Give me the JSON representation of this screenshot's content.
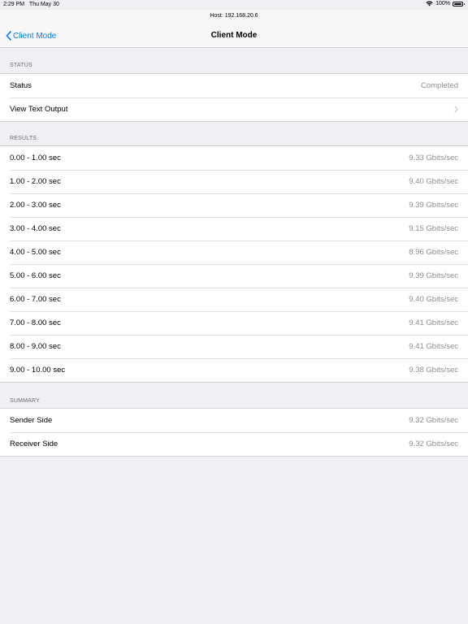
{
  "status_bar": {
    "time": "2:29 PM",
    "date": "Thu May 30",
    "battery": "100%",
    "wifi_icon": "wifi-icon",
    "battery_icon": "battery-icon"
  },
  "nav": {
    "prompt": "Host: 192.168.20.6",
    "back_label": "Client Mode",
    "title": "Client Mode"
  },
  "status_section": {
    "header": "STATUS",
    "rows": [
      {
        "label": "Status",
        "value": "Completed"
      },
      {
        "label": "View Text Output",
        "value": ""
      }
    ]
  },
  "results_section": {
    "header": "RESULTS",
    "rows": [
      {
        "label": "0.00 - 1.00 sec",
        "value": "9.33 Gbits/sec"
      },
      {
        "label": "1.00 - 2.00 sec",
        "value": "9.40 Gbits/sec"
      },
      {
        "label": "2.00 - 3.00 sec",
        "value": "9.39 Gbits/sec"
      },
      {
        "label": "3.00 - 4.00 sec",
        "value": "9.15 Gbits/sec"
      },
      {
        "label": "4.00 - 5.00 sec",
        "value": "8.96 Gbits/sec"
      },
      {
        "label": "5.00 - 6.00 sec",
        "value": "9.39 Gbits/sec"
      },
      {
        "label": "6.00 - 7.00 sec",
        "value": "9.40 Gbits/sec"
      },
      {
        "label": "7.00 - 8.00 sec",
        "value": "9.41 Gbits/sec"
      },
      {
        "label": "8.00 - 9.00 sec",
        "value": "9.41 Gbits/sec"
      },
      {
        "label": "9.00 - 10.00 sec",
        "value": "9.38 Gbits/sec"
      }
    ]
  },
  "summary_section": {
    "header": "SUMMARY",
    "rows": [
      {
        "label": "Sender Side",
        "value": "9.32 Gbits/sec"
      },
      {
        "label": "Receiver Side",
        "value": "9.32 Gbits/sec"
      }
    ]
  },
  "colors": {
    "accent": "#007aff",
    "background": "#efeff4",
    "secondary_text": "#8e8e93"
  }
}
